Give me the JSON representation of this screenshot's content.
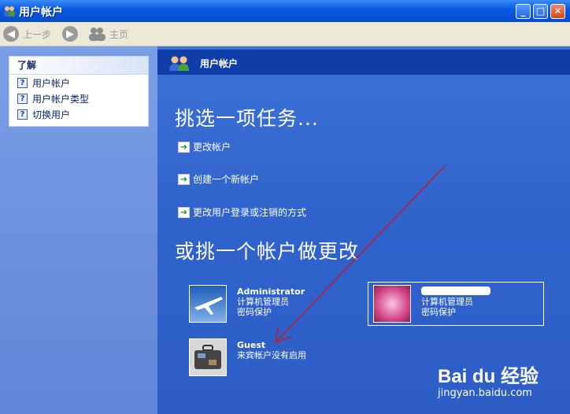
{
  "window": {
    "title": "用户帐户",
    "buttons": {
      "minimize": "_",
      "maximize": "□",
      "close": "✕"
    }
  },
  "toolbar": {
    "back_label": "上一步",
    "home_label": "主页"
  },
  "sidebar": {
    "learn_title": "了解",
    "items": [
      {
        "label": "用户帐户",
        "icon": "help-icon"
      },
      {
        "label": "用户帐户类型",
        "icon": "help-icon"
      },
      {
        "label": "切换用户",
        "icon": "help-icon"
      }
    ]
  },
  "main": {
    "header_title": "用户帐户",
    "pick_task_heading": "挑选一项任务...",
    "tasks": [
      {
        "label": "更改帐户"
      },
      {
        "label": "创建一个新帐户"
      },
      {
        "label": "更改用户登录或注销的方式"
      }
    ],
    "pick_account_heading": "或挑一个帐户做更改",
    "accounts": [
      {
        "name": "Administrator",
        "type": "计算机管理员",
        "status": "密码保护",
        "picture": "airplane"
      },
      {
        "name": "",
        "type": "计算机管理员",
        "status": "密码保护",
        "picture": "flower"
      },
      {
        "name": "Guest",
        "type": "来宾帐户没有启用",
        "status": "",
        "picture": "briefcase"
      }
    ]
  },
  "watermark": {
    "logo": "Bai du 经验",
    "domain": "jingyan.baidu.com"
  },
  "colors": {
    "title_bar": "#0a5ce6",
    "content_bg": "#3d72d6",
    "header_bar": "#0f3ea8",
    "sidebar_bg": "#7b9fe6",
    "annotation_arrow": "#c0182a"
  }
}
